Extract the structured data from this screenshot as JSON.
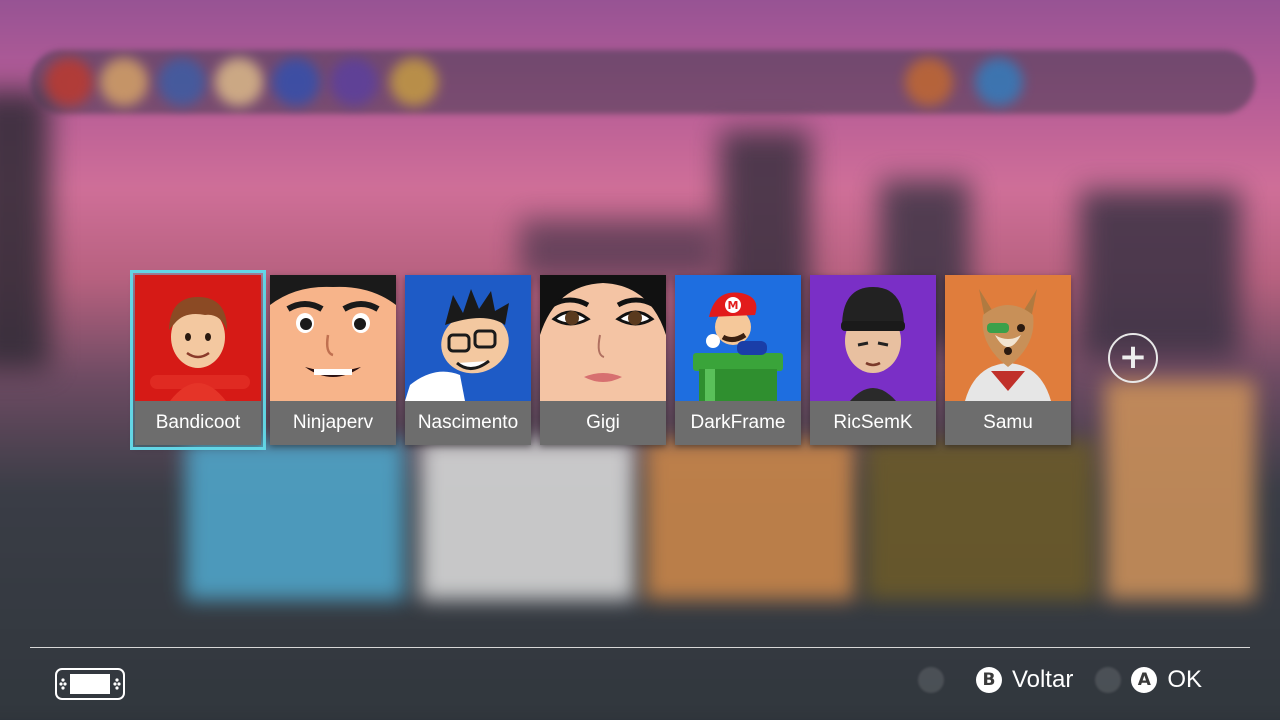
{
  "users": [
    {
      "name": "Bandicoot",
      "avatar": "mii-red-avatar",
      "selected": true
    },
    {
      "name": "Ninjaperv",
      "avatar": "mii-face-avatar",
      "selected": false
    },
    {
      "name": "Nascimento",
      "avatar": "mii-glasses-avatar",
      "selected": false
    },
    {
      "name": "Gigi",
      "avatar": "mii-female-avatar",
      "selected": false
    },
    {
      "name": "DarkFrame",
      "avatar": "mario-pipe-avatar",
      "selected": false
    },
    {
      "name": "RicSemK",
      "avatar": "mii-beanie-avatar",
      "selected": false
    },
    {
      "name": "Samu",
      "avatar": "fox-avatar",
      "selected": false
    }
  ],
  "add_user": {
    "icon": "plus-icon",
    "symbol": "+"
  },
  "footer": {
    "back": {
      "button": "B",
      "label": "Voltar"
    },
    "ok": {
      "button": "A",
      "label": "OK"
    },
    "console_icon": "switch-console-icon"
  },
  "colors": {
    "selection": "#63d6e6",
    "name_bar": "#6d6d6d",
    "background": "#2d3339"
  }
}
